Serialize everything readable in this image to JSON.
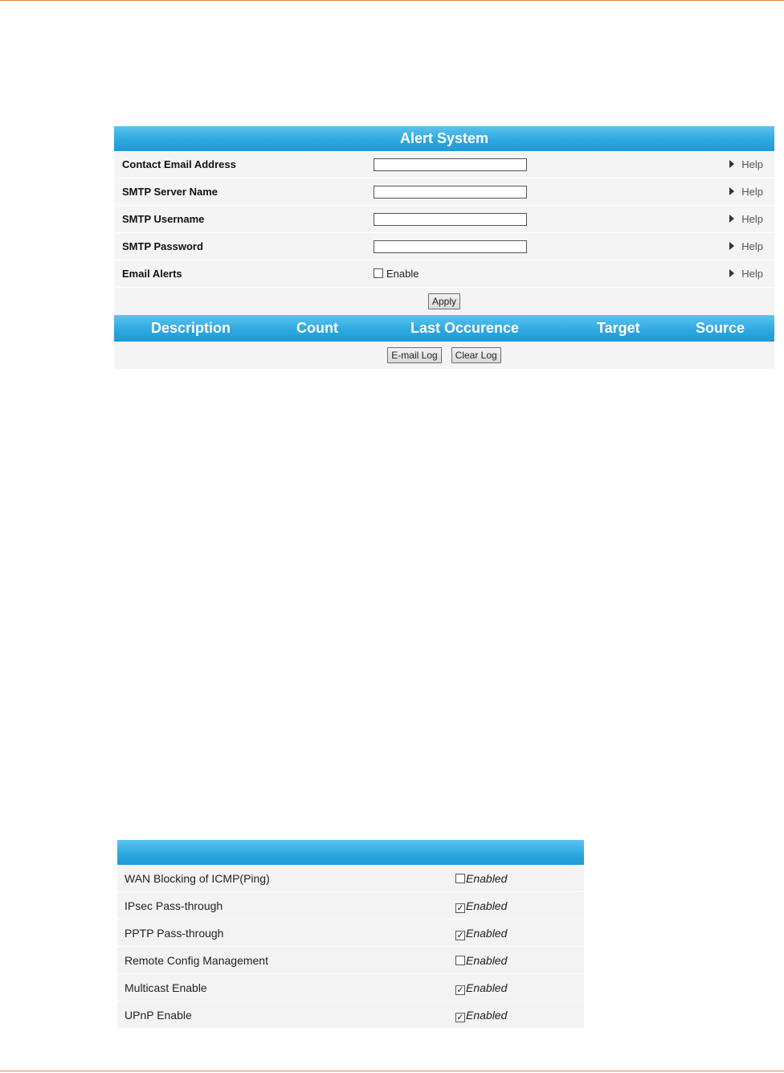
{
  "alert_system": {
    "title": "Alert System",
    "fields": [
      {
        "label": "Contact Email Address",
        "value": "",
        "help": "Help"
      },
      {
        "label": "SMTP Server Name",
        "value": "",
        "help": "Help"
      },
      {
        "label": "SMTP Username",
        "value": "",
        "help": "Help"
      },
      {
        "label": "SMTP Password",
        "value": "",
        "help": "Help"
      }
    ],
    "email_alerts": {
      "label": "Email Alerts",
      "checkbox_label": "Enable",
      "checked": false,
      "help": "Help"
    },
    "apply_label": "Apply",
    "log_columns": [
      "Description",
      "Count",
      "Last Occurence",
      "Target",
      "Source"
    ],
    "email_log_label": "E-mail Log",
    "clear_log_label": "Clear Log"
  },
  "settings": {
    "rows": [
      {
        "label": "WAN Blocking of ICMP(Ping)",
        "state": "Enabled",
        "checked": false
      },
      {
        "label": "IPsec Pass-through",
        "state": "Enabled",
        "checked": true
      },
      {
        "label": "PPTP Pass-through",
        "state": "Enabled",
        "checked": true
      },
      {
        "label": "Remote Config Management",
        "state": "Enabled",
        "checked": false
      },
      {
        "label": "Multicast Enable",
        "state": "Enabled",
        "checked": true
      },
      {
        "label": "UPnP Enable",
        "state": "Enabled",
        "checked": true
      }
    ]
  },
  "colors": {
    "header_blue": "#2ea8e0",
    "page_rule": "#e8823c",
    "row_background": "#f4f4f4"
  }
}
